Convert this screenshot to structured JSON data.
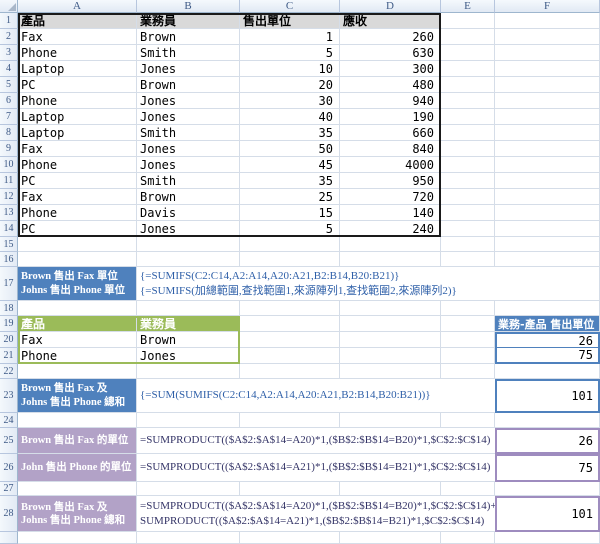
{
  "colors": {
    "accent_blue": "#4F81BD",
    "accent_green": "#9BBB59",
    "accent_purple": "#B2A2C7",
    "purple_border": "#9E8CBF",
    "formula_blue": "#2E5FA8",
    "formula_dark": "#333366",
    "header_gray": "#D9D9D9",
    "grid_line": "#D5DDE8",
    "table_border": "#1A1A1A",
    "header_text": "#3E5A86"
  },
  "sheet": {
    "col_headers": [
      "A",
      "B",
      "C",
      "D",
      "E",
      "F"
    ],
    "row_headers": [
      "1",
      "2",
      "3",
      "4",
      "5",
      "6",
      "7",
      "8",
      "9",
      "10",
      "11",
      "12",
      "13",
      "14",
      "15",
      "16",
      "17",
      "18",
      "19",
      "20",
      "21",
      "22",
      "23",
      "24",
      "25",
      "26",
      "27",
      "28",
      ""
    ]
  },
  "table": {
    "headers": {
      "product": "產品",
      "salesperson": "業務員",
      "units": "售出單位",
      "receivable": "應收"
    },
    "rows": [
      {
        "product": "Fax",
        "salesperson": "Brown",
        "units": "1",
        "receivable": "260"
      },
      {
        "product": "Phone",
        "salesperson": "Smith",
        "units": "5",
        "receivable": "630"
      },
      {
        "product": "Laptop",
        "salesperson": "Jones",
        "units": "10",
        "receivable": "300"
      },
      {
        "product": "PC",
        "salesperson": "Brown",
        "units": "20",
        "receivable": "480"
      },
      {
        "product": "Phone",
        "salesperson": "Jones",
        "units": "30",
        "receivable": "940"
      },
      {
        "product": "Laptop",
        "salesperson": "Jones",
        "units": "40",
        "receivable": "190"
      },
      {
        "product": "Laptop",
        "salesperson": "Smith",
        "units": "35",
        "receivable": "660"
      },
      {
        "product": "Fax",
        "salesperson": "Jones",
        "units": "50",
        "receivable": "840"
      },
      {
        "product": "Phone",
        "salesperson": "Jones",
        "units": "45",
        "receivable": "4000"
      },
      {
        "product": "PC",
        "salesperson": "Smith",
        "units": "35",
        "receivable": "950"
      },
      {
        "product": "Fax",
        "salesperson": "Brown",
        "units": "25",
        "receivable": "720"
      },
      {
        "product": "Phone",
        "salesperson": "Davis",
        "units": "15",
        "receivable": "140"
      },
      {
        "product": "PC",
        "salesperson": "Jones",
        "units": "5",
        "receivable": "240"
      }
    ]
  },
  "sumifs_block": {
    "label_line1": "Brown 售出 Fax 單位",
    "label_line2": "Johns 售出 Phone 單位",
    "formula_line1": "{=SUMIFS(C2:C14,A2:A14,A20:A21,B2:B14,B20:B21)}",
    "formula_line2": "{=SUMIFS(加總範圍,查找範圍1,來源陣列1,查找範圍2,來源陣列2)}"
  },
  "criteria_table": {
    "header_product": "產品",
    "header_salesperson": "業務員",
    "rows": [
      {
        "product": "Fax",
        "salesperson": "Brown"
      },
      {
        "product": "Phone",
        "salesperson": "Jones"
      }
    ]
  },
  "results": {
    "header": "業務-產品 售出單位",
    "value1": "26",
    "value2": "75"
  },
  "sum_block": {
    "label_line1": "Brown 售出 Fax 及",
    "label_line2": "Johns 售出 Phone 總和",
    "formula": "{=SUM(SUMIFS(C2:C14,A2:A14,A20:A21,B2:B14,B20:B21))}",
    "value": "101"
  },
  "sumproduct_block": {
    "row25": {
      "label": "Brown 售出 Fax 的單位",
      "formula": "=SUMPRODUCT(($A$2:$A$14=A20)*1,($B$2:$B$14=B20)*1,$C$2:$C$14)",
      "value": "26"
    },
    "row26": {
      "label": "John 售出 Phone 的單位",
      "formula": "=SUMPRODUCT(($A$2:$A$14=A21)*1,($B$2:$B$14=B21)*1,$C$2:$C$14)",
      "value": "75"
    },
    "row28": {
      "label_line1": "Brown 售出 Fax 及",
      "label_line2": "Johns 售出 Phone 總和",
      "formula_line1": "=SUMPRODUCT(($A$2:$A$14=A20)*1,($B$2:$B$14=B20)*1,$C$2:$C$14)+",
      "formula_line2": "SUMPRODUCT(($A$2:$A$14=A21)*1,($B$2:$B$14=B21)*1,$C$2:$C$14)",
      "value": "101"
    }
  }
}
